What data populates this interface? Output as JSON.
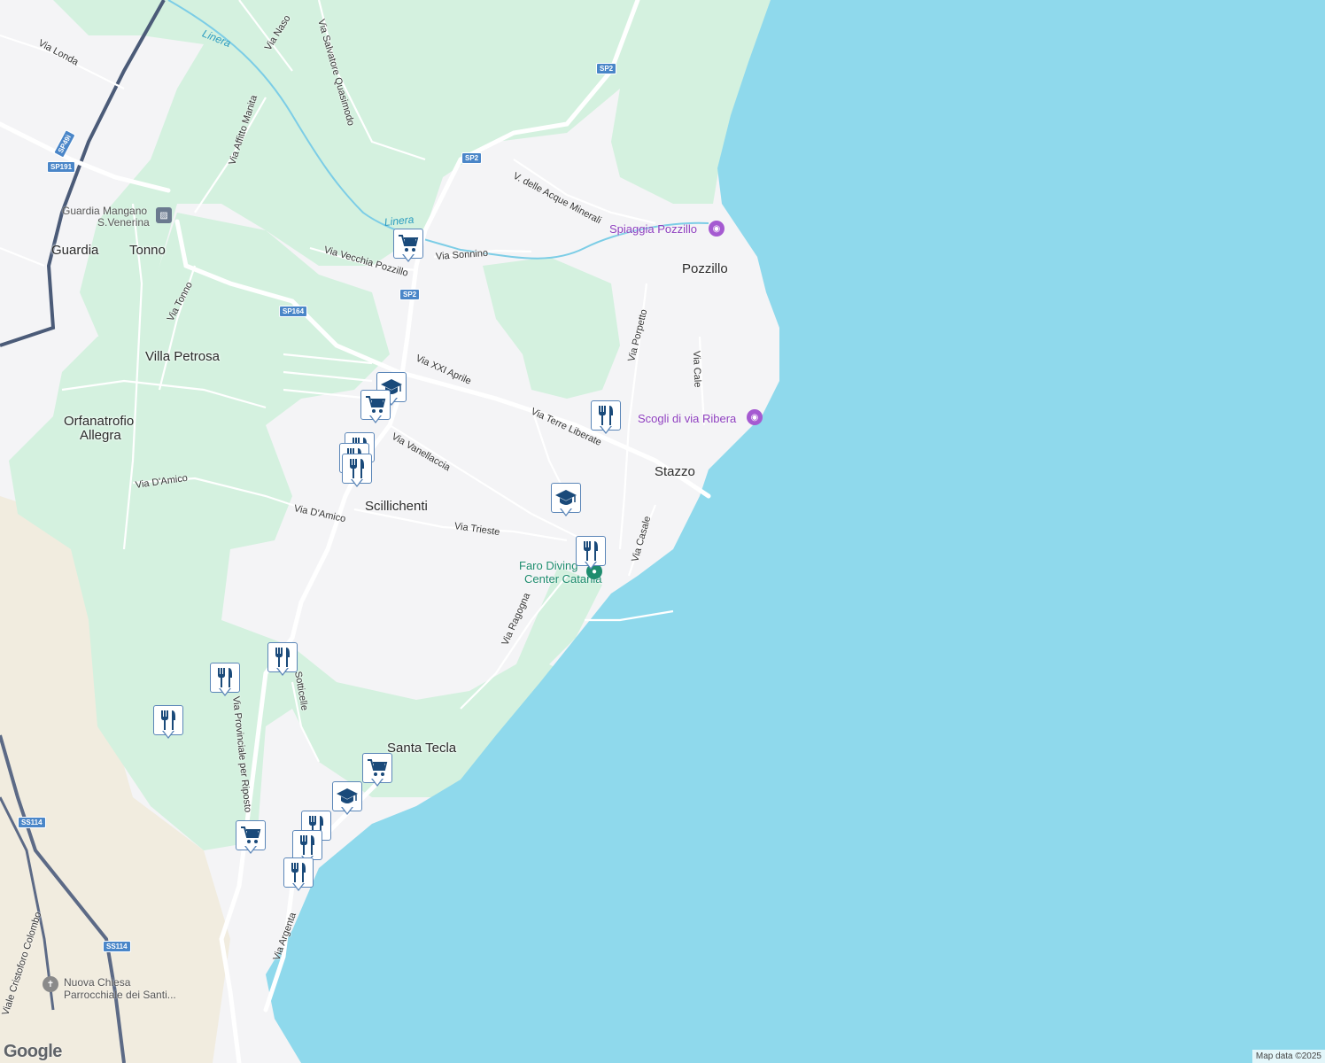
{
  "places": [
    {
      "id": "guardia",
      "text": "Guardia"
    },
    {
      "id": "tonno",
      "text": "Tonno"
    },
    {
      "id": "villa-petrosa",
      "text": "Villa Petrosa"
    },
    {
      "id": "orfanatrofio-1",
      "text": "Orfanatrofio"
    },
    {
      "id": "orfanatrofio-2",
      "text": "Allegra"
    },
    {
      "id": "pozzillo",
      "text": "Pozzillo"
    },
    {
      "id": "stazzo",
      "text": "Stazzo"
    },
    {
      "id": "scillichenti",
      "text": "Scillichenti"
    },
    {
      "id": "santa-tecla",
      "text": "Santa Tecla"
    }
  ],
  "streets": [
    {
      "id": "via-londa",
      "text": "Via Londa"
    },
    {
      "id": "via-naso",
      "text": "Via Naso"
    },
    {
      "id": "via-salvatore-quasimodo",
      "text": "Via Salvatore Quasimodo"
    },
    {
      "id": "via-affitto-manita",
      "text": "Via Affitto Manita"
    },
    {
      "id": "v-delle-acque-minerali",
      "text": "V. delle Acque Minerali"
    },
    {
      "id": "via-vecchia-pozzillo",
      "text": "Via Vecchia Pozzillo"
    },
    {
      "id": "via-sonnino",
      "text": "Via Sonnino"
    },
    {
      "id": "via-tonno",
      "text": "Via Tonno"
    },
    {
      "id": "via-xxi-aprile",
      "text": "Via XXI Aprile"
    },
    {
      "id": "via-porpetto",
      "text": "Via Porpetto"
    },
    {
      "id": "via-cale",
      "text": "Via Cale"
    },
    {
      "id": "via-terre-liberate",
      "text": "Via Terre Liberate"
    },
    {
      "id": "via-vanellaccia",
      "text": "Via Vanellaccia"
    },
    {
      "id": "via-d-amico-1",
      "text": "Via D'Amico"
    },
    {
      "id": "via-d-amico-2",
      "text": "Via D'Amico"
    },
    {
      "id": "via-trieste",
      "text": "Via Trieste"
    },
    {
      "id": "via-casale",
      "text": "Via Casale"
    },
    {
      "id": "via-ragogna",
      "text": "Via Ragogna"
    },
    {
      "id": "via-sotticelle",
      "text": "Sotticelle"
    },
    {
      "id": "via-provinciale-riposto",
      "text": "Via Provinciale per Riposto"
    },
    {
      "id": "via-argenta",
      "text": "Via Argenta"
    },
    {
      "id": "viale-cristoforo-colombo",
      "text": "Viale Cristoforo Colombo"
    }
  ],
  "waterways": [
    {
      "id": "linera-1",
      "text": "Linera"
    },
    {
      "id": "linera-2",
      "text": "Linera"
    }
  ],
  "shields": [
    {
      "id": "sp2-a",
      "text": "SP2"
    },
    {
      "id": "sp2-b",
      "text": "SP2"
    },
    {
      "id": "sp2-c",
      "text": "SP2"
    },
    {
      "id": "sp49i",
      "text": "SP49i"
    },
    {
      "id": "sp191",
      "text": "SP191"
    },
    {
      "id": "sp164",
      "text": "SP164"
    },
    {
      "id": "ss114-a",
      "text": "SS114"
    },
    {
      "id": "ss114-b",
      "text": "SS114"
    }
  ],
  "pois": [
    {
      "id": "spiaggia-pozzillo",
      "text": "Spiaggia Pozzillo",
      "color": "#8e3fbf"
    },
    {
      "id": "scogli-via-ribera",
      "text": "Scogli di via Ribera",
      "color": "#8e3fbf"
    },
    {
      "id": "faro-diving-1",
      "text": "Faro Diving",
      "color": "#1e8c6e"
    },
    {
      "id": "faro-diving-2",
      "text": "Center Catania",
      "color": "#1e8c6e"
    },
    {
      "id": "guardia-mangano-1",
      "text": "Guardia Mangano",
      "color": "#555555"
    },
    {
      "id": "guardia-mangano-2",
      "text": "S.Venerina",
      "color": "#555555"
    },
    {
      "id": "nuova-chiesa-1",
      "text": "Nuova Chiesa",
      "color": "#555555"
    },
    {
      "id": "nuova-chiesa-2",
      "text": "Parrocchiale dei Santi...",
      "color": "#555555"
    }
  ],
  "markers": [
    {
      "id": "m1",
      "icon": "shopping-cart-icon"
    },
    {
      "id": "m2",
      "icon": "school-icon"
    },
    {
      "id": "m3",
      "icon": "shopping-cart-icon"
    },
    {
      "id": "m4",
      "icon": "restaurant-icon"
    },
    {
      "id": "m5",
      "icon": "restaurant-icon"
    },
    {
      "id": "m6",
      "icon": "restaurant-icon"
    },
    {
      "id": "m7",
      "icon": "restaurant-icon"
    },
    {
      "id": "m8",
      "icon": "school-icon"
    },
    {
      "id": "m9",
      "icon": "restaurant-icon"
    },
    {
      "id": "m10",
      "icon": "restaurant-icon"
    },
    {
      "id": "m11",
      "icon": "restaurant-icon"
    },
    {
      "id": "m12",
      "icon": "restaurant-icon"
    },
    {
      "id": "m13",
      "icon": "shopping-cart-icon"
    },
    {
      "id": "m14",
      "icon": "school-icon"
    },
    {
      "id": "m15",
      "icon": "restaurant-icon"
    },
    {
      "id": "m16",
      "icon": "restaurant-icon"
    },
    {
      "id": "m17",
      "icon": "shopping-cart-icon"
    },
    {
      "id": "m18",
      "icon": "restaurant-icon"
    }
  ],
  "colors": {
    "sea": "#8fd9ec",
    "land": "#f4f4f6",
    "green": "#d4f1df",
    "sand": "#f1ecdf",
    "road": "#ffffff",
    "highway": "#4b5b78",
    "marker_icon": "#1a4a7a"
  },
  "branding": {
    "logo": "Google",
    "attribution": "Map data ©2025"
  }
}
